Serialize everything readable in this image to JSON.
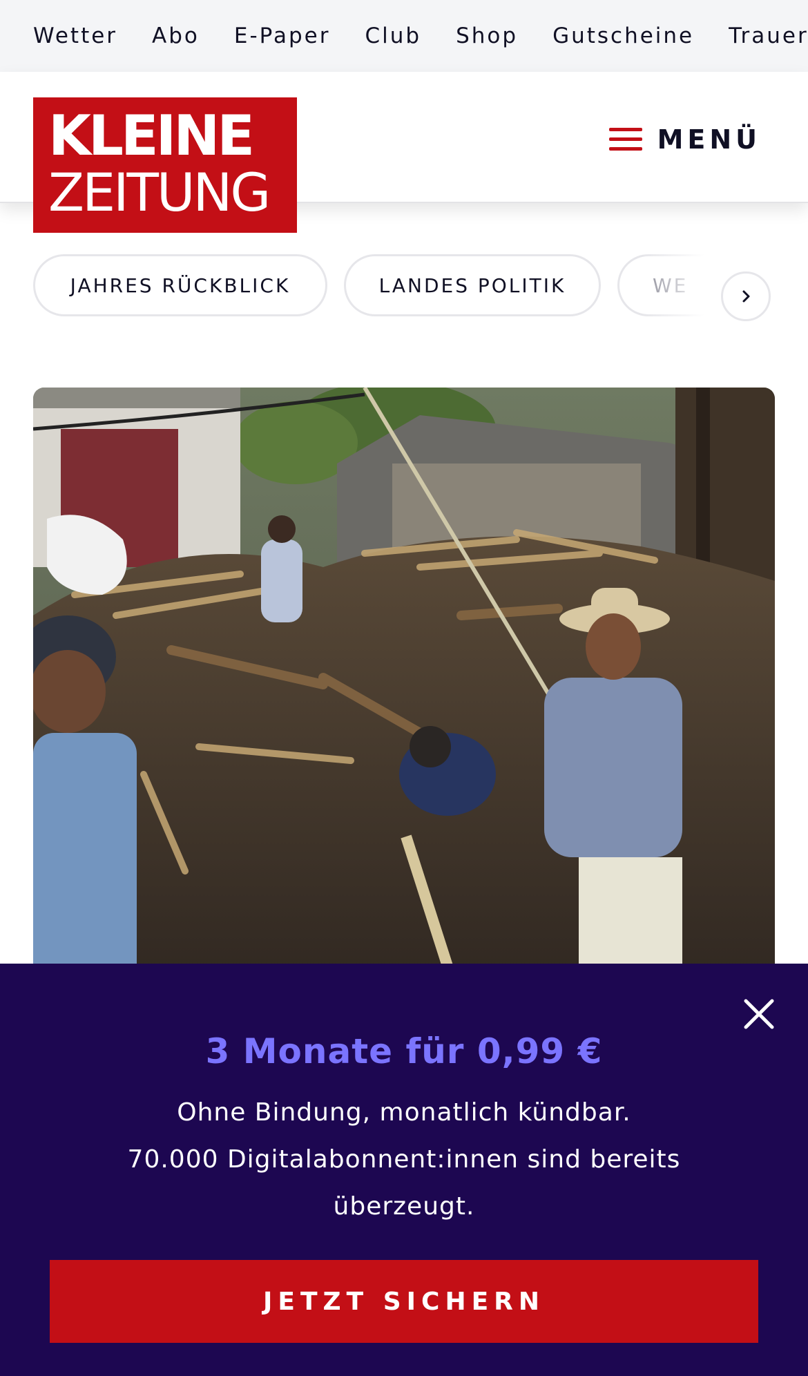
{
  "topnav": {
    "items": [
      "Wetter",
      "Abo",
      "E-Paper",
      "Club",
      "Shop",
      "Gutscheine",
      "Trauerpo"
    ]
  },
  "header": {
    "logo": {
      "line1": "KLEINE",
      "line2": "ZEITUNG"
    },
    "menu_label": "MENÜ"
  },
  "topics": {
    "items": [
      "JAHRES RÜCKBLICK",
      "LANDES POLITIK",
      "WE"
    ]
  },
  "paywall": {
    "title": "3 Monate für 0,99 €",
    "subtitle": "Ohne Bindung, monatlich kündbar.",
    "text": "70.000 Digitalabonnent:innen sind bereits überzeugt.",
    "cta_label": "JETZT SICHERN"
  },
  "colors": {
    "brand_red": "#c30f16",
    "paywall_bg": "#1d0751",
    "accent_violet": "#7b74ff"
  },
  "icons": {
    "menu": "hamburger-icon",
    "chips_next": "chevron-right-icon",
    "close": "close-icon"
  }
}
